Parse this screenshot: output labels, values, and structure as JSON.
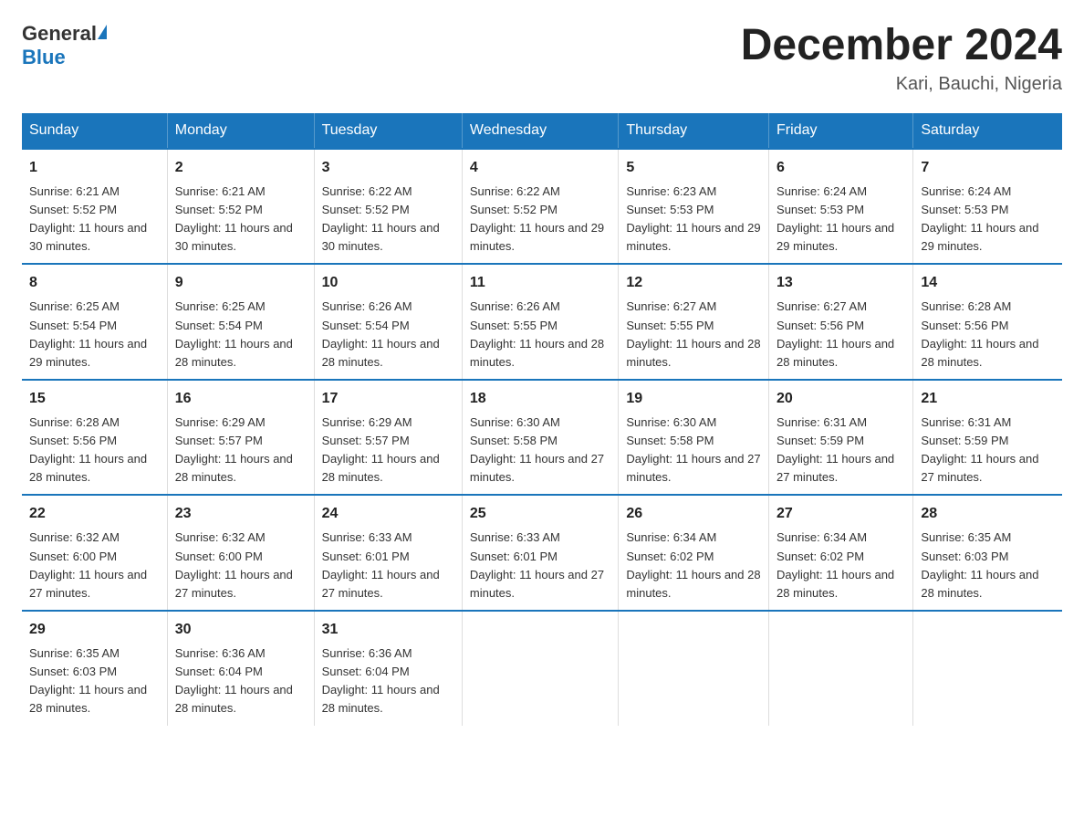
{
  "header": {
    "logo": {
      "general": "General",
      "blue": "Blue"
    },
    "title": "December 2024",
    "location": "Kari, Bauchi, Nigeria"
  },
  "weekdays": [
    "Sunday",
    "Monday",
    "Tuesday",
    "Wednesday",
    "Thursday",
    "Friday",
    "Saturday"
  ],
  "weeks": [
    [
      {
        "day": "1",
        "sunrise": "Sunrise: 6:21 AM",
        "sunset": "Sunset: 5:52 PM",
        "daylight": "Daylight: 11 hours and 30 minutes."
      },
      {
        "day": "2",
        "sunrise": "Sunrise: 6:21 AM",
        "sunset": "Sunset: 5:52 PM",
        "daylight": "Daylight: 11 hours and 30 minutes."
      },
      {
        "day": "3",
        "sunrise": "Sunrise: 6:22 AM",
        "sunset": "Sunset: 5:52 PM",
        "daylight": "Daylight: 11 hours and 30 minutes."
      },
      {
        "day": "4",
        "sunrise": "Sunrise: 6:22 AM",
        "sunset": "Sunset: 5:52 PM",
        "daylight": "Daylight: 11 hours and 29 minutes."
      },
      {
        "day": "5",
        "sunrise": "Sunrise: 6:23 AM",
        "sunset": "Sunset: 5:53 PM",
        "daylight": "Daylight: 11 hours and 29 minutes."
      },
      {
        "day": "6",
        "sunrise": "Sunrise: 6:24 AM",
        "sunset": "Sunset: 5:53 PM",
        "daylight": "Daylight: 11 hours and 29 minutes."
      },
      {
        "day": "7",
        "sunrise": "Sunrise: 6:24 AM",
        "sunset": "Sunset: 5:53 PM",
        "daylight": "Daylight: 11 hours and 29 minutes."
      }
    ],
    [
      {
        "day": "8",
        "sunrise": "Sunrise: 6:25 AM",
        "sunset": "Sunset: 5:54 PM",
        "daylight": "Daylight: 11 hours and 29 minutes."
      },
      {
        "day": "9",
        "sunrise": "Sunrise: 6:25 AM",
        "sunset": "Sunset: 5:54 PM",
        "daylight": "Daylight: 11 hours and 28 minutes."
      },
      {
        "day": "10",
        "sunrise": "Sunrise: 6:26 AM",
        "sunset": "Sunset: 5:54 PM",
        "daylight": "Daylight: 11 hours and 28 minutes."
      },
      {
        "day": "11",
        "sunrise": "Sunrise: 6:26 AM",
        "sunset": "Sunset: 5:55 PM",
        "daylight": "Daylight: 11 hours and 28 minutes."
      },
      {
        "day": "12",
        "sunrise": "Sunrise: 6:27 AM",
        "sunset": "Sunset: 5:55 PM",
        "daylight": "Daylight: 11 hours and 28 minutes."
      },
      {
        "day": "13",
        "sunrise": "Sunrise: 6:27 AM",
        "sunset": "Sunset: 5:56 PM",
        "daylight": "Daylight: 11 hours and 28 minutes."
      },
      {
        "day": "14",
        "sunrise": "Sunrise: 6:28 AM",
        "sunset": "Sunset: 5:56 PM",
        "daylight": "Daylight: 11 hours and 28 minutes."
      }
    ],
    [
      {
        "day": "15",
        "sunrise": "Sunrise: 6:28 AM",
        "sunset": "Sunset: 5:56 PM",
        "daylight": "Daylight: 11 hours and 28 minutes."
      },
      {
        "day": "16",
        "sunrise": "Sunrise: 6:29 AM",
        "sunset": "Sunset: 5:57 PM",
        "daylight": "Daylight: 11 hours and 28 minutes."
      },
      {
        "day": "17",
        "sunrise": "Sunrise: 6:29 AM",
        "sunset": "Sunset: 5:57 PM",
        "daylight": "Daylight: 11 hours and 28 minutes."
      },
      {
        "day": "18",
        "sunrise": "Sunrise: 6:30 AM",
        "sunset": "Sunset: 5:58 PM",
        "daylight": "Daylight: 11 hours and 27 minutes."
      },
      {
        "day": "19",
        "sunrise": "Sunrise: 6:30 AM",
        "sunset": "Sunset: 5:58 PM",
        "daylight": "Daylight: 11 hours and 27 minutes."
      },
      {
        "day": "20",
        "sunrise": "Sunrise: 6:31 AM",
        "sunset": "Sunset: 5:59 PM",
        "daylight": "Daylight: 11 hours and 27 minutes."
      },
      {
        "day": "21",
        "sunrise": "Sunrise: 6:31 AM",
        "sunset": "Sunset: 5:59 PM",
        "daylight": "Daylight: 11 hours and 27 minutes."
      }
    ],
    [
      {
        "day": "22",
        "sunrise": "Sunrise: 6:32 AM",
        "sunset": "Sunset: 6:00 PM",
        "daylight": "Daylight: 11 hours and 27 minutes."
      },
      {
        "day": "23",
        "sunrise": "Sunrise: 6:32 AM",
        "sunset": "Sunset: 6:00 PM",
        "daylight": "Daylight: 11 hours and 27 minutes."
      },
      {
        "day": "24",
        "sunrise": "Sunrise: 6:33 AM",
        "sunset": "Sunset: 6:01 PM",
        "daylight": "Daylight: 11 hours and 27 minutes."
      },
      {
        "day": "25",
        "sunrise": "Sunrise: 6:33 AM",
        "sunset": "Sunset: 6:01 PM",
        "daylight": "Daylight: 11 hours and 27 minutes."
      },
      {
        "day": "26",
        "sunrise": "Sunrise: 6:34 AM",
        "sunset": "Sunset: 6:02 PM",
        "daylight": "Daylight: 11 hours and 28 minutes."
      },
      {
        "day": "27",
        "sunrise": "Sunrise: 6:34 AM",
        "sunset": "Sunset: 6:02 PM",
        "daylight": "Daylight: 11 hours and 28 minutes."
      },
      {
        "day": "28",
        "sunrise": "Sunrise: 6:35 AM",
        "sunset": "Sunset: 6:03 PM",
        "daylight": "Daylight: 11 hours and 28 minutes."
      }
    ],
    [
      {
        "day": "29",
        "sunrise": "Sunrise: 6:35 AM",
        "sunset": "Sunset: 6:03 PM",
        "daylight": "Daylight: 11 hours and 28 minutes."
      },
      {
        "day": "30",
        "sunrise": "Sunrise: 6:36 AM",
        "sunset": "Sunset: 6:04 PM",
        "daylight": "Daylight: 11 hours and 28 minutes."
      },
      {
        "day": "31",
        "sunrise": "Sunrise: 6:36 AM",
        "sunset": "Sunset: 6:04 PM",
        "daylight": "Daylight: 11 hours and 28 minutes."
      },
      {
        "day": "",
        "sunrise": "",
        "sunset": "",
        "daylight": ""
      },
      {
        "day": "",
        "sunrise": "",
        "sunset": "",
        "daylight": ""
      },
      {
        "day": "",
        "sunrise": "",
        "sunset": "",
        "daylight": ""
      },
      {
        "day": "",
        "sunrise": "",
        "sunset": "",
        "daylight": ""
      }
    ]
  ]
}
